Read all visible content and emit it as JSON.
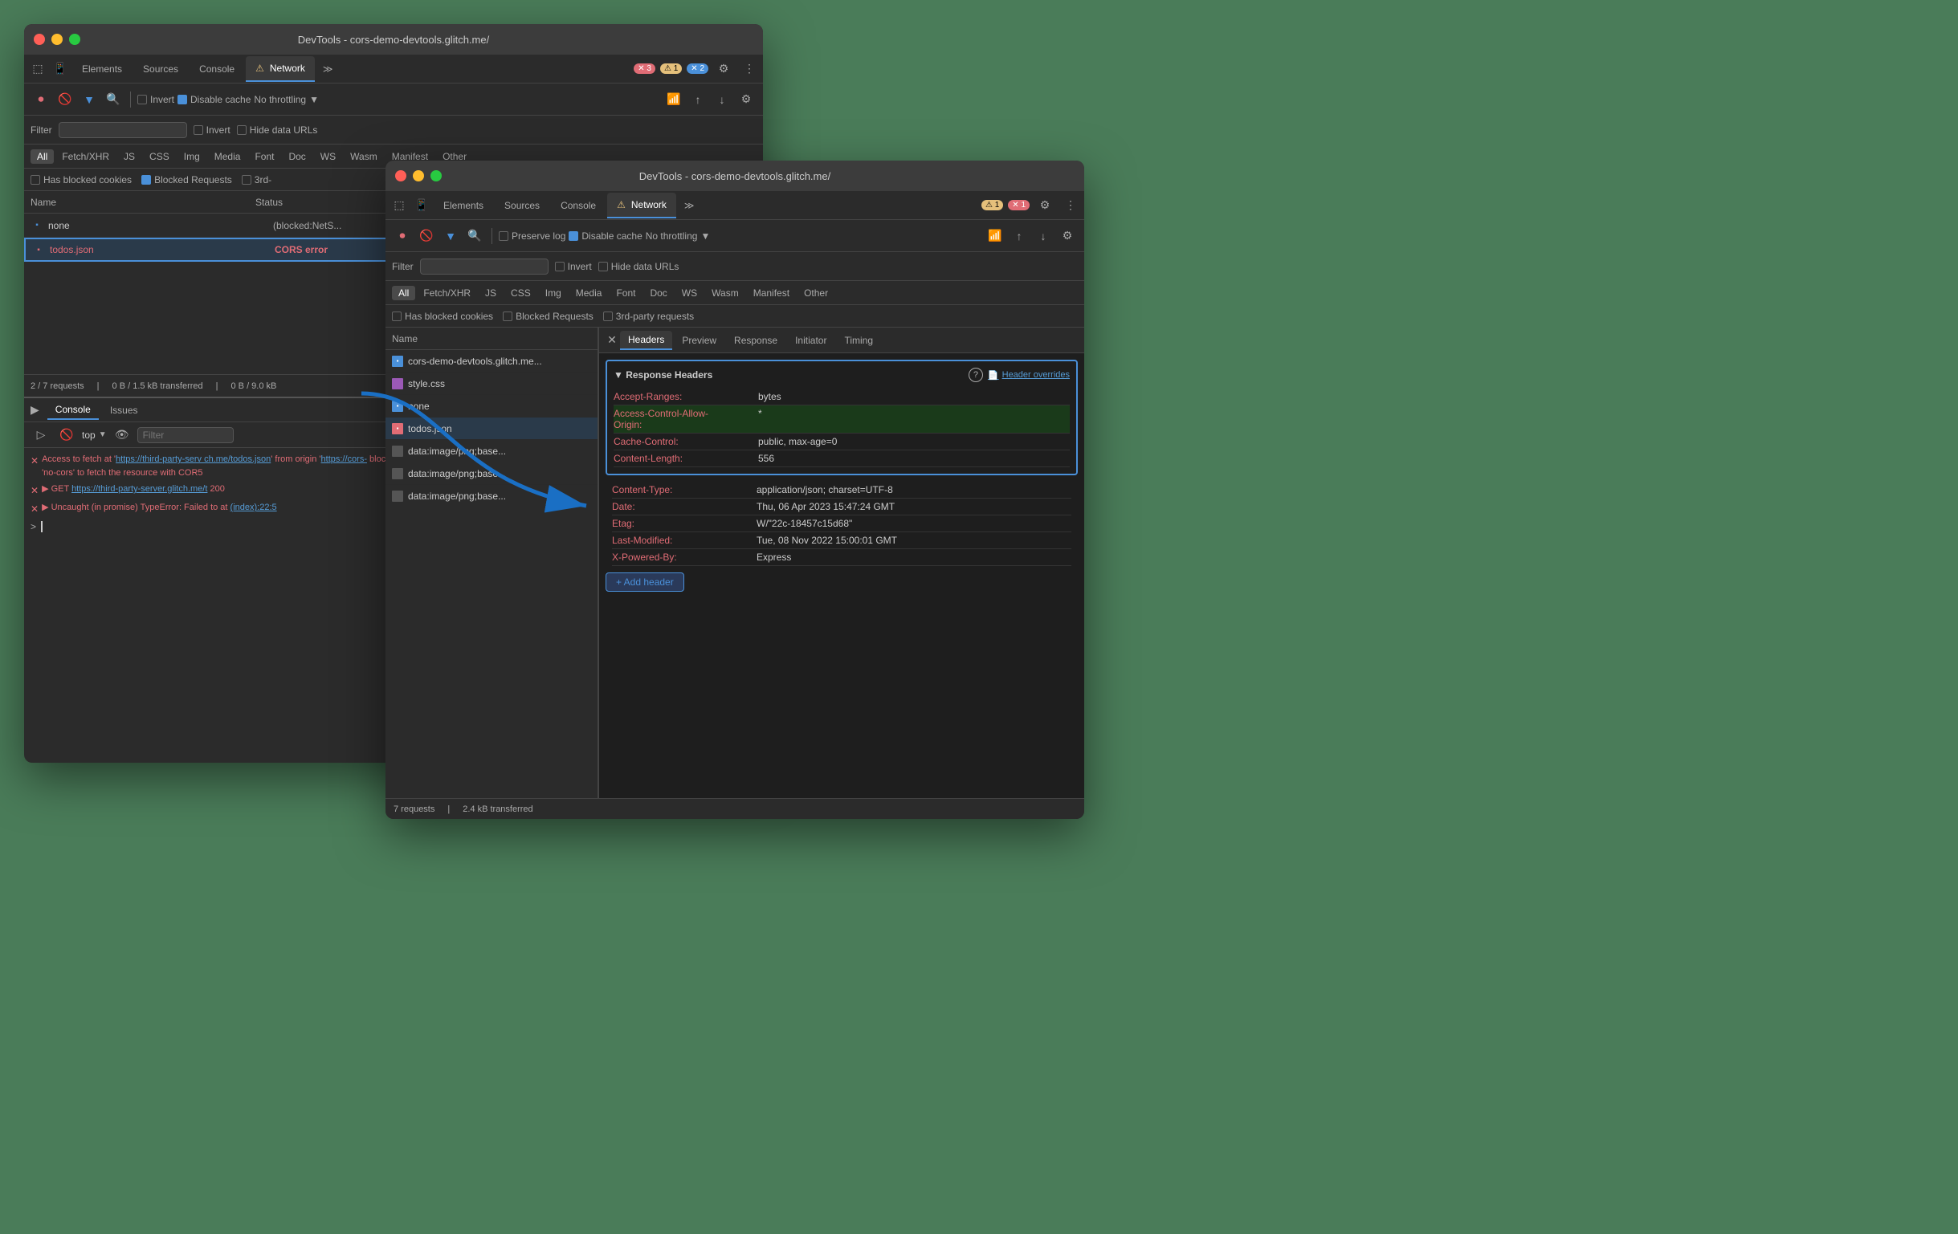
{
  "window_back": {
    "title": "DevTools - cors-demo-devtools.glitch.me/",
    "tabs": [
      {
        "label": "Elements",
        "active": false
      },
      {
        "label": "Sources",
        "active": false
      },
      {
        "label": "Console",
        "active": false
      },
      {
        "label": "Network",
        "active": true
      },
      {
        "label": "≫",
        "active": false
      }
    ],
    "badges": {
      "errors": "✕ 3",
      "warnings": "⚠ 1",
      "blue": "✕ 2"
    },
    "filter_bar": {
      "placeholder": "Filter",
      "invert_label": "Invert",
      "hide_data_label": "Hide data URLs"
    },
    "type_filters": [
      "All",
      "Fetch/XHR",
      "JS",
      "CSS",
      "Img",
      "Media",
      "Font",
      "Doc",
      "WS",
      "Wasm",
      "Manifest",
      "Other"
    ],
    "cookies_bar": {
      "blocked_cookies": "Has blocked cookies",
      "blocked_requests": "Blocked Requests",
      "third_party": "3rd-"
    },
    "table_headers": [
      "Name",
      "Status"
    ],
    "rows": [
      {
        "name": "none",
        "status": "(blocked:NetS...",
        "icon": "doc",
        "cors": false
      },
      {
        "name": "todos.json",
        "status": "CORS error",
        "icon": "doc-red",
        "cors": true
      }
    ],
    "status_bar": {
      "requests": "2 / 7 requests",
      "transferred": "0 B / 1.5 kB transferred",
      "resources": "0 B / 9.0 kB"
    },
    "console": {
      "tabs": [
        "Console",
        "Issues"
      ],
      "errors": [
        {
          "text": "Access to fetch at 'https://third-party-serv ch.me/todos.json' from origin 'https://cors- blocked by CORS policy: No 'Access-Control-A requested resource. If an opaque response se to 'no-cors' to fetch the resource with COR5"
        },
        {
          "text": "▶ GET https://third-party-server.glitch.me/t 200"
        },
        {
          "text": "▶ Uncaught (in promise) TypeError: Failed to at (index):22:5"
        }
      ]
    }
  },
  "window_front": {
    "title": "DevTools - cors-demo-devtools.glitch.me/",
    "tabs": [
      {
        "label": "Elements",
        "active": false
      },
      {
        "label": "Sources",
        "active": false
      },
      {
        "label": "Console",
        "active": false
      },
      {
        "label": "Network",
        "active": true
      },
      {
        "label": "≫",
        "active": false
      }
    ],
    "badges": {
      "warnings": "⚠ 1",
      "errors": "✕ 1"
    },
    "filter_bar": {
      "placeholder": "Filter",
      "invert_label": "Invert",
      "hide_data_label": "Hide data URLs"
    },
    "type_filters": [
      "All",
      "Fetch/XHR",
      "JS",
      "CSS",
      "Img",
      "Media",
      "Font",
      "Doc",
      "WS",
      "Wasm",
      "Manifest",
      "Other"
    ],
    "cookies_bar": {
      "blocked_cookies": "Has blocked cookies",
      "blocked_requests": "Blocked Requests",
      "third_party": "3rd-party requests"
    },
    "name_list": [
      {
        "name": "cors-demo-devtools.glitch.me...",
        "icon": "doc"
      },
      {
        "name": "style.css",
        "icon": "css"
      },
      {
        "name": "none",
        "icon": "doc"
      },
      {
        "name": "todos.json",
        "icon": "doc-red",
        "selected": true
      },
      {
        "name": "data:image/png;base...",
        "icon": "data"
      },
      {
        "name": "data:image/png;base...",
        "icon": "data"
      },
      {
        "name": "data:image/png;base...",
        "icon": "data"
      }
    ],
    "panel_tabs": [
      "Headers",
      "Preview",
      "Response",
      "Initiator",
      "Timing"
    ],
    "response_headers": {
      "title": "▼ Response Headers",
      "override_label": "Header overrides",
      "headers": [
        {
          "key": "Accept-Ranges:",
          "value": "bytes",
          "highlighted": false
        },
        {
          "key": "Access-Control-Allow-Origin:",
          "value": "*",
          "highlighted": true
        },
        {
          "key": "Cache-Control:",
          "value": "public, max-age=0",
          "highlighted": false
        },
        {
          "key": "Content-Length:",
          "value": "556",
          "highlighted": false
        },
        {
          "key": "Content-Type:",
          "value": "application/json; charset=UTF-8",
          "highlighted": false
        },
        {
          "key": "Date:",
          "value": "Thu, 06 Apr 2023 15:47:24 GMT",
          "highlighted": false
        },
        {
          "key": "Etag:",
          "value": "W/\"22c-18457c15d68\"",
          "highlighted": false
        },
        {
          "key": "Last-Modified:",
          "value": "Tue, 08 Nov 2022 15:00:01 GMT",
          "highlighted": false
        },
        {
          "key": "X-Powered-By:",
          "value": "Express",
          "highlighted": false
        }
      ],
      "add_header_label": "+ Add header"
    },
    "status_bar": {
      "requests": "7 requests",
      "transferred": "2.4 kB transferred"
    }
  }
}
